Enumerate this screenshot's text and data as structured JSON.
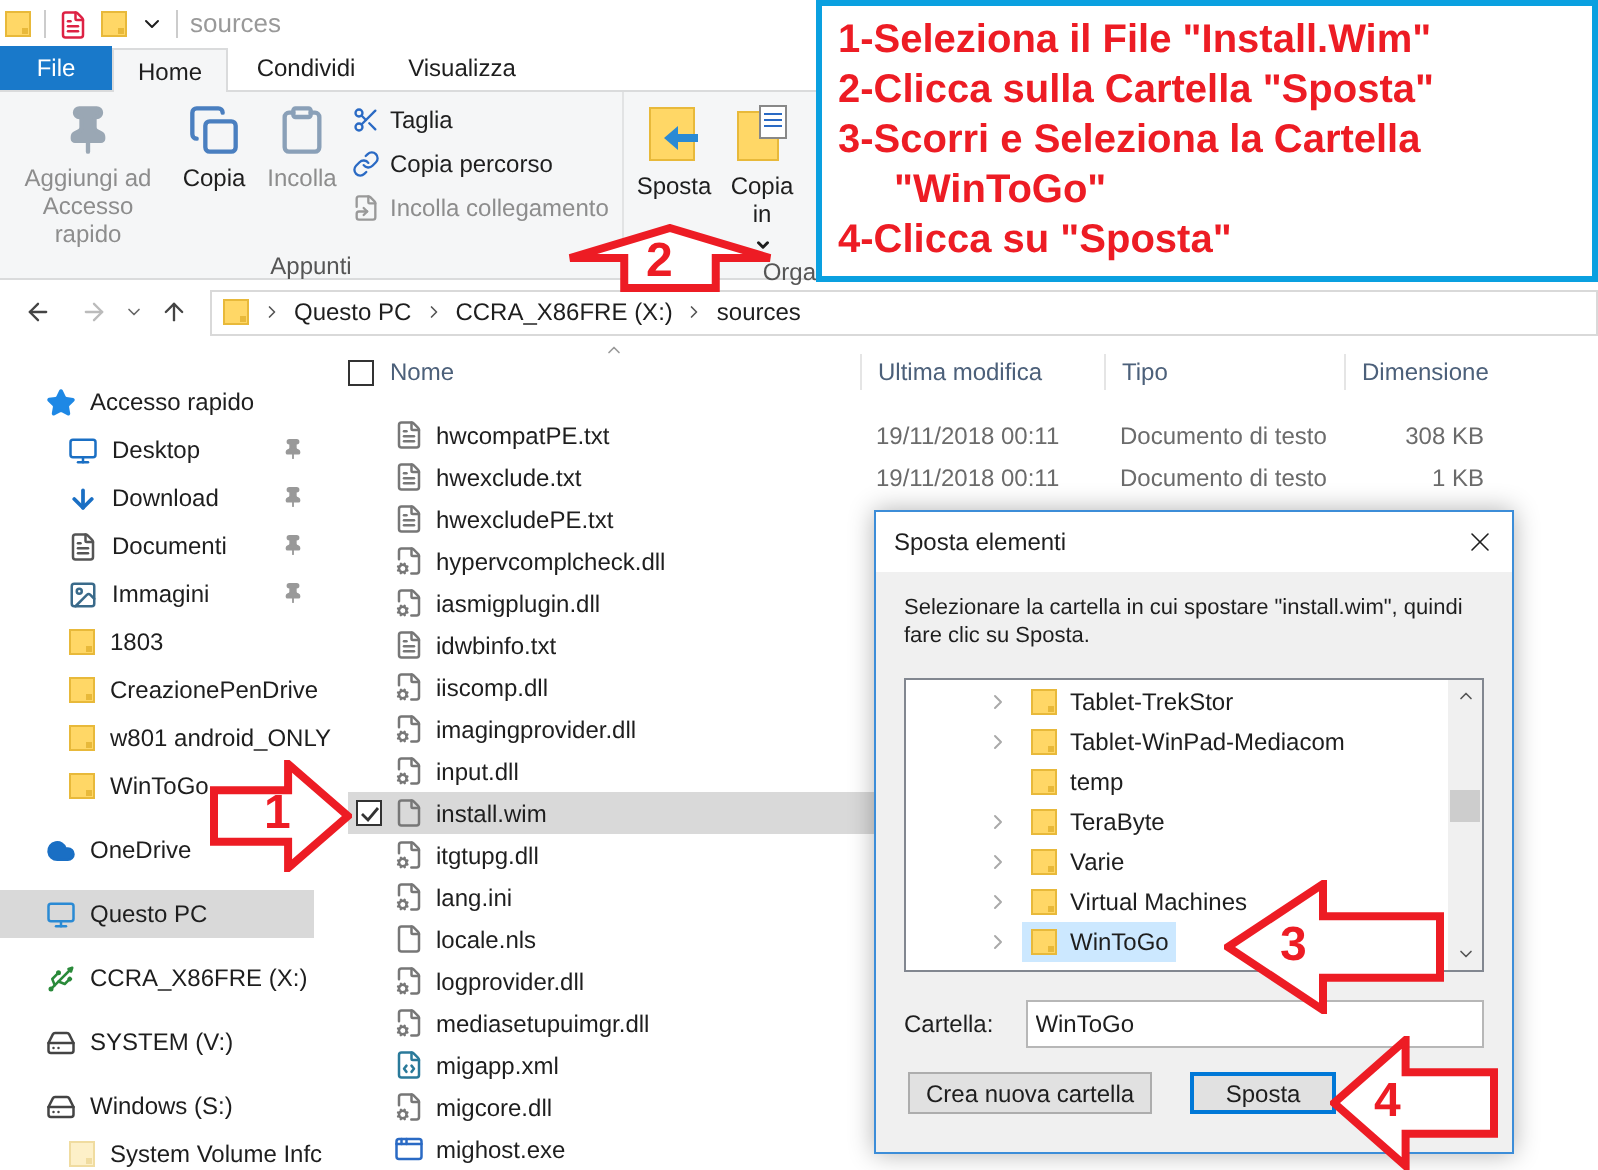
{
  "window": {
    "title": "sources"
  },
  "ribbon_tabs": [
    {
      "label": "File",
      "kind": "file",
      "selected": false
    },
    {
      "label": "Home",
      "kind": "tab",
      "selected": true
    },
    {
      "label": "Condividi",
      "kind": "tab",
      "selected": false
    },
    {
      "label": "Visualizza",
      "kind": "tab",
      "selected": false
    }
  ],
  "ribbon": {
    "groups": [
      {
        "label": "Appunti",
        "large_buttons": [
          {
            "label": "Aggiungi ad Accesso rapido",
            "disabled": true,
            "dropdown": false
          },
          {
            "label": "Copia",
            "disabled": false,
            "dropdown": false
          },
          {
            "label": "Incolla",
            "disabled": true,
            "dropdown": false
          }
        ],
        "small_buttons": [
          {
            "label": "Taglia",
            "disabled": false
          },
          {
            "label": "Copia percorso",
            "disabled": false
          },
          {
            "label": "Incolla collegamento",
            "disabled": true
          }
        ]
      },
      {
        "label": "Orga",
        "large_buttons": [
          {
            "label": "Sposta",
            "disabled": false,
            "dropdown": false
          },
          {
            "label": "Copia in",
            "disabled": false,
            "dropdown": true
          }
        ]
      }
    ]
  },
  "address": {
    "crumbs": [
      "Questo PC",
      "CCRA_X86FRE (X:)",
      "sources"
    ]
  },
  "sidebar": {
    "items": [
      {
        "label": "Accesso rapido",
        "kind": "section",
        "pinned": false,
        "selected": false
      },
      {
        "label": "Desktop",
        "kind": "item",
        "pinned": true,
        "selected": false
      },
      {
        "label": "Download",
        "kind": "item",
        "pinned": true,
        "selected": false
      },
      {
        "label": "Documenti",
        "kind": "item",
        "pinned": true,
        "selected": false
      },
      {
        "label": "Immagini",
        "kind": "item",
        "pinned": true,
        "selected": false
      },
      {
        "label": "1803",
        "kind": "item",
        "pinned": false,
        "selected": false
      },
      {
        "label": "CreazionePenDrive",
        "kind": "item",
        "pinned": false,
        "selected": false
      },
      {
        "label": "w801 android_ONLY",
        "kind": "item",
        "pinned": false,
        "selected": false
      },
      {
        "label": "WinToGo",
        "kind": "item",
        "pinned": false,
        "selected": false
      },
      {
        "label": "OneDrive",
        "kind": "section",
        "pinned": false,
        "selected": false
      },
      {
        "label": "Questo PC",
        "kind": "section",
        "pinned": false,
        "selected": true
      },
      {
        "label": "CCRA_X86FRE (X:)",
        "kind": "section",
        "pinned": false,
        "selected": false
      },
      {
        "label": "SYSTEM (V:)",
        "kind": "section",
        "pinned": false,
        "selected": false
      },
      {
        "label": "Windows (S:)",
        "kind": "section",
        "pinned": false,
        "selected": false
      },
      {
        "label": "System Volume Infc",
        "kind": "item",
        "pinned": false,
        "selected": false
      }
    ]
  },
  "table": {
    "select_all_checked": false,
    "columns": [
      "Nome",
      "Ultima modifica",
      "Tipo",
      "Dimensione"
    ],
    "rows": [
      {
        "name": "hwcompatPE.txt",
        "kind": "text",
        "selected": false,
        "modified": "19/11/2018 00:11",
        "type": "Documento di testo",
        "size": "308 KB"
      },
      {
        "name": "hwexclude.txt",
        "kind": "text",
        "selected": false,
        "modified": "19/11/2018 00:11",
        "type": "Documento di testo",
        "size": "1 KB"
      },
      {
        "name": "hwexcludePE.txt",
        "kind": "text",
        "selected": false
      },
      {
        "name": "hypervcomplcheck.dll",
        "kind": "library",
        "selected": false
      },
      {
        "name": "iasmigplugin.dll",
        "kind": "library",
        "selected": false
      },
      {
        "name": "idwbinfo.txt",
        "kind": "text",
        "selected": false
      },
      {
        "name": "iiscomp.dll",
        "kind": "library",
        "selected": false
      },
      {
        "name": "imagingprovider.dll",
        "kind": "library",
        "selected": false
      },
      {
        "name": "input.dll",
        "kind": "library",
        "selected": false
      },
      {
        "name": "install.wim",
        "kind": "blank",
        "selected": true
      },
      {
        "name": "itgtupg.dll",
        "kind": "library",
        "selected": false
      },
      {
        "name": "lang.ini",
        "kind": "settings",
        "selected": false
      },
      {
        "name": "locale.nls",
        "kind": "blank",
        "selected": false
      },
      {
        "name": "logprovider.dll",
        "kind": "library",
        "selected": false
      },
      {
        "name": "mediasetupuimgr.dll",
        "kind": "library",
        "selected": false
      },
      {
        "name": "migapp.xml",
        "kind": "markup",
        "selected": false
      },
      {
        "name": "migcore.dll",
        "kind": "library",
        "selected": false
      },
      {
        "name": "mighost.exe",
        "kind": "program",
        "selected": false
      }
    ]
  },
  "dialog": {
    "title": "Sposta elementi",
    "message": "Selezionare la cartella in cui spostare \"install.wim\", quindi fare clic su Sposta.",
    "folders": [
      {
        "label": "Tablet-TrekStor",
        "has_children": true,
        "selected": false
      },
      {
        "label": "Tablet-WinPad-Mediacom",
        "has_children": true,
        "selected": false
      },
      {
        "label": "temp",
        "has_children": false,
        "selected": false
      },
      {
        "label": "TeraByte",
        "has_children": true,
        "selected": false
      },
      {
        "label": "Varie",
        "has_children": true,
        "selected": false
      },
      {
        "label": "Virtual Machines",
        "has_children": true,
        "selected": false
      },
      {
        "label": "WinToGo",
        "has_children": true,
        "selected": true
      }
    ],
    "folder_label": "Cartella:",
    "folder_value": "WinToGo",
    "buttons": [
      {
        "label": "Crea nuova cartella",
        "default": false
      },
      {
        "label": "Sposta",
        "default": true
      }
    ]
  },
  "instructions": [
    "1-Seleziona il File \"Install.Wim\"",
    "2-Clicca sulla Cartella \"Sposta\"",
    "3-Scorri e Seleziona la Cartella \"WinToGo\"",
    "4-Clicca su \"Sposta\""
  ],
  "callouts": [
    {
      "number": "1",
      "kind": "right"
    },
    {
      "number": "2",
      "kind": "up"
    },
    {
      "number": "3",
      "kind": "left"
    },
    {
      "number": "4",
      "kind": "left"
    }
  ]
}
